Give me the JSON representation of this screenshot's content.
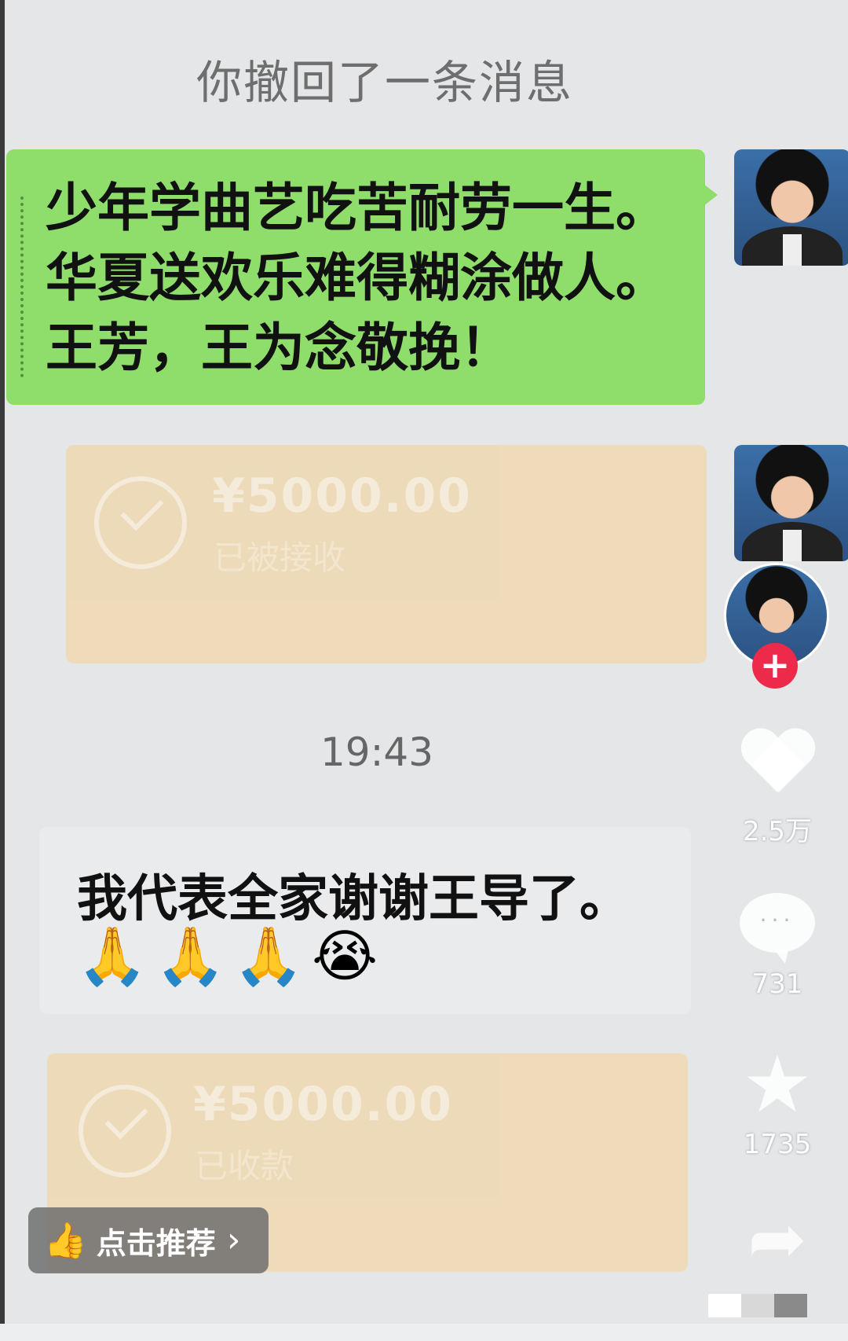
{
  "system_notice": "你撤回了一条消息",
  "message_green": {
    "lines": [
      "少年学曲艺吃苦耐劳一生。",
      "华夏送欢乐难得糊涂做人。",
      "王芳，王为念敬挽！"
    ]
  },
  "transfer_1": {
    "amount": "¥5000.00",
    "status": "已被接收"
  },
  "timestamp": "19:43",
  "message_white": {
    "text": "我代表全家谢谢王导了。",
    "emojis": [
      "🙏",
      "🙏",
      "🙏",
      "😭"
    ]
  },
  "transfer_2": {
    "amount": "¥5000.00",
    "status": "已收款"
  },
  "side_actions": {
    "follow_plus": "+",
    "like_count": "2.5万",
    "comment_count": "731",
    "favorite_count": "1735"
  },
  "recommend": {
    "label": "点击推荐",
    "chevron": "›"
  },
  "icons": {
    "like": "heart-icon",
    "comment": "comment-icon",
    "favorite": "star-icon",
    "share": "share-icon",
    "thumb": "thumbs-up-icon"
  },
  "colors": {
    "green_bubble": "#8fdd6b",
    "transfer_card": "#efd9b4",
    "follow_red": "#ee2a4b"
  }
}
